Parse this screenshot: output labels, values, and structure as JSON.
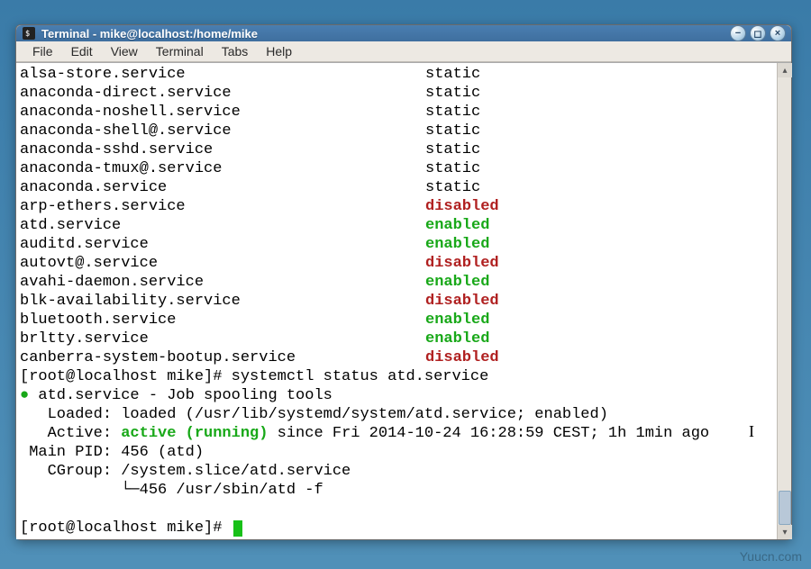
{
  "window": {
    "title": "Terminal - mike@localhost:/home/mike"
  },
  "menubar": [
    "File",
    "Edit",
    "View",
    "Terminal",
    "Tabs",
    "Help"
  ],
  "services": [
    {
      "name": "alsa-store.service",
      "status": "static"
    },
    {
      "name": "anaconda-direct.service",
      "status": "static"
    },
    {
      "name": "anaconda-noshell.service",
      "status": "static"
    },
    {
      "name": "anaconda-shell@.service",
      "status": "static"
    },
    {
      "name": "anaconda-sshd.service",
      "status": "static"
    },
    {
      "name": "anaconda-tmux@.service",
      "status": "static"
    },
    {
      "name": "anaconda.service",
      "status": "static"
    },
    {
      "name": "arp-ethers.service",
      "status": "disabled"
    },
    {
      "name": "atd.service",
      "status": "enabled"
    },
    {
      "name": "auditd.service",
      "status": "enabled"
    },
    {
      "name": "autovt@.service",
      "status": "disabled"
    },
    {
      "name": "avahi-daemon.service",
      "status": "enabled"
    },
    {
      "name": "blk-availability.service",
      "status": "disabled"
    },
    {
      "name": "bluetooth.service",
      "status": "enabled"
    },
    {
      "name": "brltty.service",
      "status": "enabled"
    },
    {
      "name": "canberra-system-bootup.service",
      "status": "disabled"
    }
  ],
  "prompt1": "[root@localhost mike]# ",
  "command1": "systemctl status atd.service",
  "status": {
    "header": " atd.service - Job spooling tools",
    "loaded": "   Loaded: loaded (/usr/lib/systemd/system/atd.service; enabled)",
    "active_prefix": "   Active: ",
    "active_state": "active (running)",
    "active_suffix": " since Fri 2014-10-24 16:28:59 CEST; 1h 1min ago",
    "mainpid": " Main PID: 456 (atd)",
    "cgroup1": "   CGroup: /system.slice/atd.service",
    "cgroup2": "           └─456 /usr/sbin/atd -f"
  },
  "prompt2": "[root@localhost mike]# ",
  "watermark": "Yuucn.com"
}
